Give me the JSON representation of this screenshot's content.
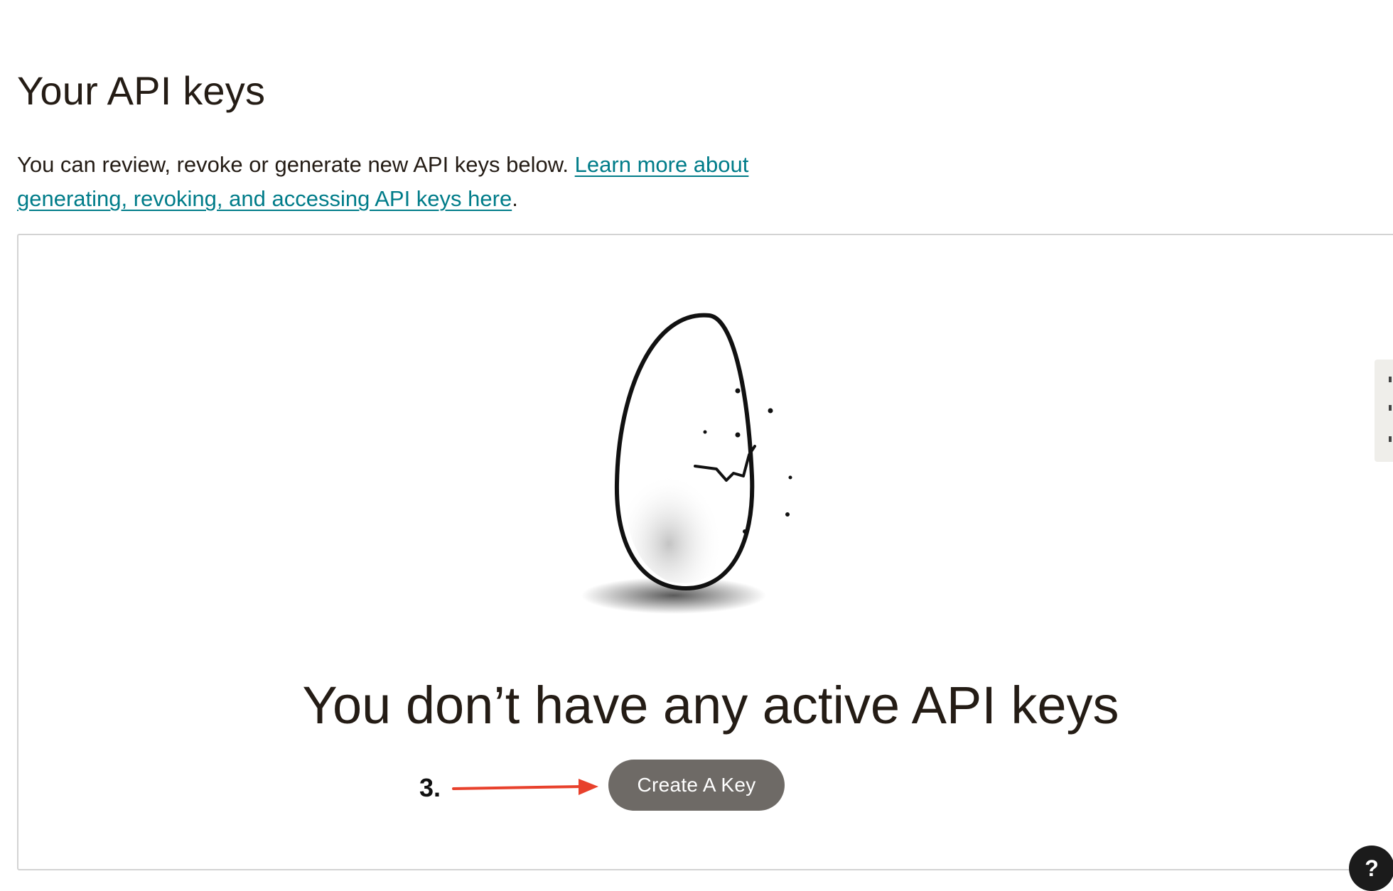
{
  "header": {
    "title": "Your API keys"
  },
  "intro": {
    "text": "You can review, revoke or generate new API keys below.",
    "link_text": "Learn more about generating, revoking, and accessing API keys here",
    "suffix": "."
  },
  "empty_state": {
    "illustration": "cracked-egg-illustration",
    "heading": "You don’t have any active API keys",
    "create_button_label": "Create A Key"
  },
  "annotation": {
    "step_label": "3.",
    "arrow_color": "#e8412c"
  },
  "help": {
    "label": "?"
  },
  "colors": {
    "link": "#007c89",
    "button_bg": "#6e6a66",
    "text": "#241c15"
  }
}
